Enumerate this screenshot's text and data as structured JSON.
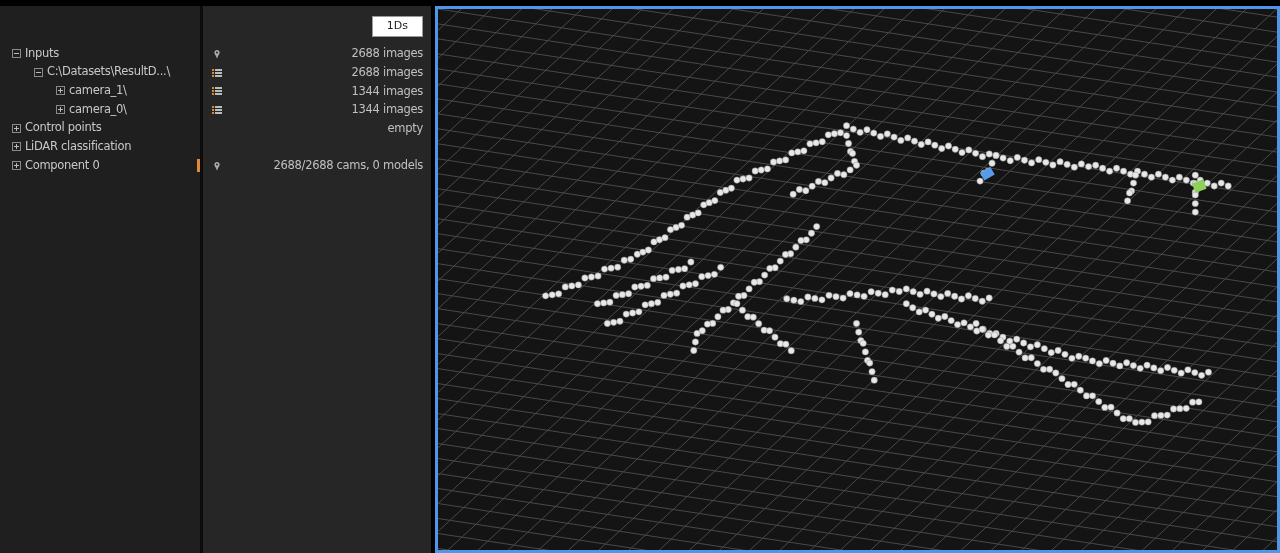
{
  "toolbar": {
    "badge": "1Ds"
  },
  "tree": [
    {
      "label": "Inputs",
      "expanded": true,
      "kind": "group",
      "value": "2688 images",
      "children": [
        {
          "label": "C:\\Datasets\\ResultD...\\",
          "expanded": true,
          "kind": "folder",
          "value": "2688 images",
          "children": [
            {
              "label": "camera_1\\",
              "expanded": false,
              "kind": "folder",
              "value": "1344 images"
            },
            {
              "label": "camera_0\\",
              "expanded": false,
              "kind": "folder",
              "value": "1344 images"
            }
          ]
        }
      ]
    },
    {
      "label": "Control points",
      "expanded": false,
      "value": "empty"
    },
    {
      "label": "LiDAR classification",
      "expanded": false
    },
    {
      "label": "Component 0",
      "expanded": false,
      "kind": "group",
      "value": "2688/2688 cams, 0 models",
      "flagged": true
    }
  ],
  "viewport": {
    "selected": true
  }
}
